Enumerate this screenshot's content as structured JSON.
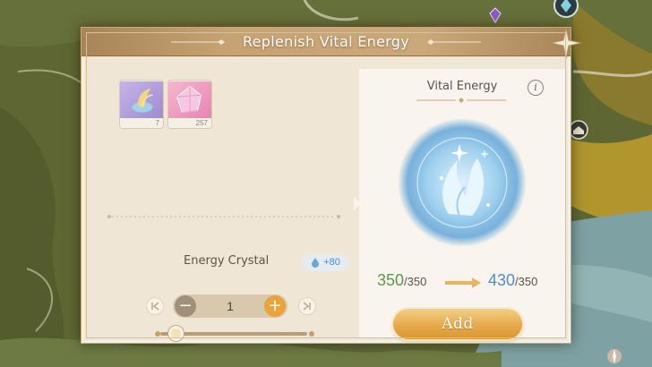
{
  "dialog": {
    "title": "Replenish Vital Energy"
  },
  "items": [
    {
      "name": "feather-crystal-item",
      "count": "7",
      "color": "#b9a6dd"
    },
    {
      "name": "pink-gem-item",
      "count": "257",
      "color": "#f0a9c8"
    }
  ],
  "crystal": {
    "label": "Energy Crystal",
    "bonus": "+80",
    "icon": "water-drop-icon"
  },
  "stepper": {
    "value": "1",
    "minus_label": "−",
    "plus_label": "+"
  },
  "slider": {
    "fraction": 0.08
  },
  "vital_energy": {
    "title": "Vital Energy",
    "info_label": "i",
    "current": "350",
    "current_max": "/350",
    "after": "430",
    "after_max": "/350"
  },
  "actions": {
    "add_label": "Add"
  },
  "colors": {
    "accent": "#e6a94a",
    "energy_current": "#5f9653",
    "energy_after": "#4f8ec8",
    "title_bar": "#c7a374"
  }
}
